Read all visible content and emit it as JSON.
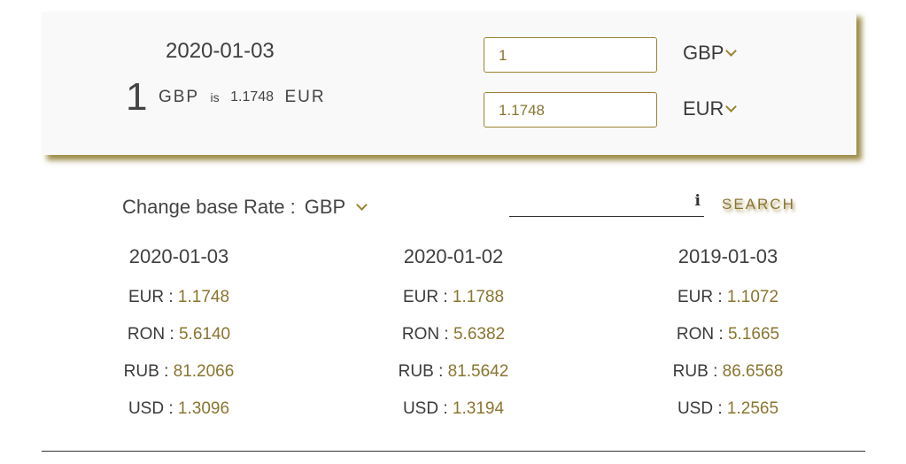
{
  "converter": {
    "date": "2020-01-03",
    "summary_amount": "1",
    "summary_from": "GBP",
    "summary_is": "is",
    "summary_rate": "1.1748",
    "summary_to": "EUR",
    "from_amount": "1",
    "to_amount": "1.1748",
    "from_currency": "GBP",
    "to_currency": "EUR"
  },
  "base": {
    "label": "Change base Rate :",
    "value": "GBP"
  },
  "search": {
    "button_label": "SEARCH",
    "info_icon": "i"
  },
  "rates": [
    {
      "date": "2020-01-03",
      "rows": [
        {
          "code": "EUR :",
          "value": "1.1748"
        },
        {
          "code": "RON :",
          "value": "5.6140"
        },
        {
          "code": "RUB :",
          "value": "81.2066"
        },
        {
          "code": "USD :",
          "value": "1.3096"
        }
      ]
    },
    {
      "date": "2020-01-02",
      "rows": [
        {
          "code": "EUR :",
          "value": "1.1788"
        },
        {
          "code": "RON :",
          "value": "5.6382"
        },
        {
          "code": "RUB :",
          "value": "81.5642"
        },
        {
          "code": "USD :",
          "value": "1.3194"
        }
      ]
    },
    {
      "date": "2019-01-03",
      "rows": [
        {
          "code": "EUR :",
          "value": "1.1072"
        },
        {
          "code": "RON :",
          "value": "5.1665"
        },
        {
          "code": "RUB :",
          "value": "86.6568"
        },
        {
          "code": "USD :",
          "value": "1.2565"
        }
      ]
    }
  ],
  "colors": {
    "accent": "#8a7530",
    "shadow": "#8b7828",
    "card_bg": "#f9f9f9",
    "text": "#3a3a3a"
  }
}
